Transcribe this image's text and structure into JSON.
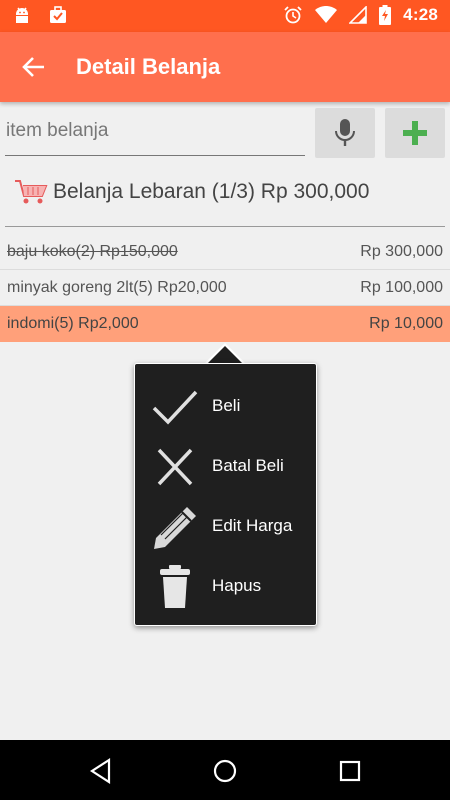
{
  "status_bar": {
    "time": "4:28",
    "icons": [
      "android-icon",
      "briefcase-check-icon",
      "alarm-icon",
      "wifi-icon",
      "signal-icon",
      "battery-charging-icon"
    ]
  },
  "app_bar": {
    "title": "Detail Belanja",
    "back_icon": "arrow-left-icon"
  },
  "input_row": {
    "placeholder": "item belanja",
    "mic_icon": "microphone-icon",
    "add_icon": "plus-icon"
  },
  "list": {
    "header": "Belanja Lebaran (1/3) Rp 300,000",
    "items": [
      {
        "name": "baju koko(2)  Rp150,000",
        "total": "Rp 300,000"
      },
      {
        "name": "minyak goreng 2lt(5)  Rp20,000",
        "total": "Rp 100,000"
      },
      {
        "name": "indomi(5)  Rp2,000",
        "total": "Rp 10,000"
      }
    ]
  },
  "context_menu": {
    "items": [
      {
        "label": "Beli",
        "icon": "check-icon"
      },
      {
        "label": "Batal Beli",
        "icon": "close-icon"
      },
      {
        "label": "Edit Harga",
        "icon": "pencil-icon"
      },
      {
        "label": "Hapus",
        "icon": "trash-icon"
      }
    ]
  },
  "colors": {
    "status_bar": "#ff5722",
    "app_bar": "#ff6f4d",
    "selected_row": "#ffa07a",
    "add_plus": "#4caf50"
  }
}
